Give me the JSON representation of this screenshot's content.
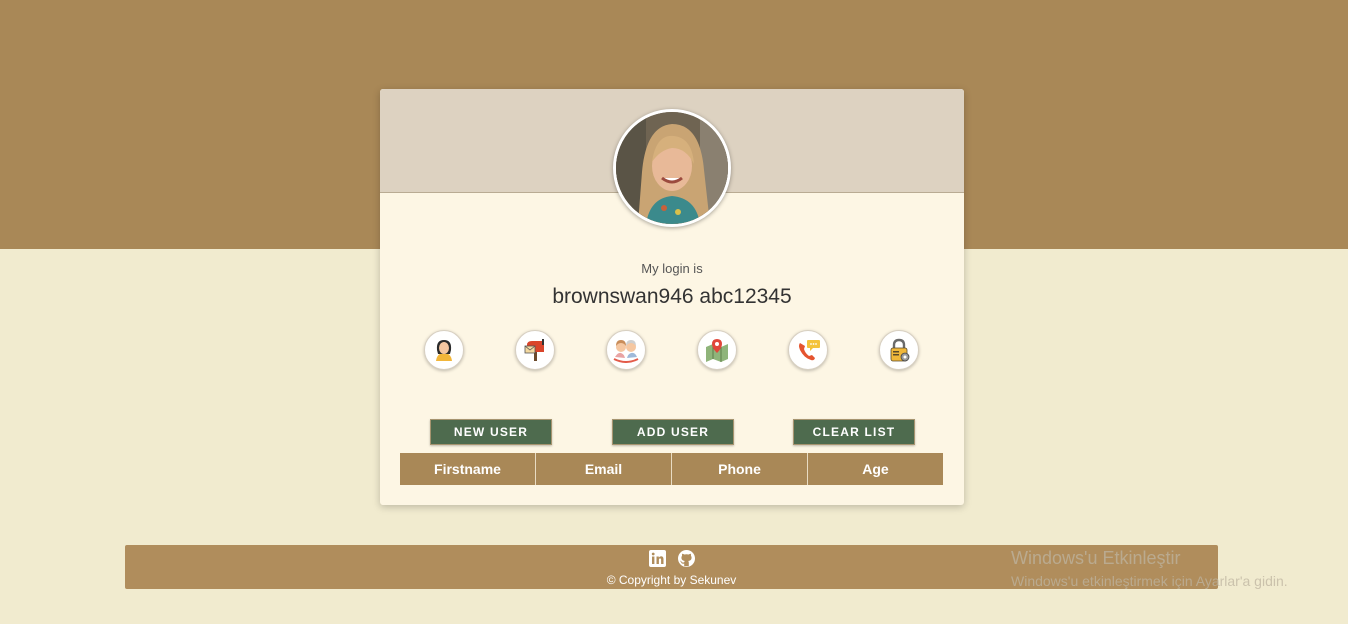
{
  "colors": {
    "top_band": "#a98857",
    "page_bg": "#f1ebcf",
    "card_bg": "#fdf6e4",
    "card_header": "#ddd2c1",
    "button": "#4e6b4e",
    "table_header": "#a98857",
    "footer": "#b08d5c"
  },
  "profile": {
    "login_label": "My login is",
    "login_value": "brownswan946 abc12345"
  },
  "icon_buttons": [
    "woman-avatar-icon",
    "mailbox-icon",
    "couple-age-icon",
    "map-location-icon",
    "phone-chat-icon",
    "padlock-icon"
  ],
  "buttons": {
    "new_user": "NEW USER",
    "add_user": "ADD USER",
    "clear_list": "CLEAR LIST"
  },
  "table": {
    "headers": [
      "Firstname",
      "Email",
      "Phone",
      "Age"
    ],
    "rows": []
  },
  "footer": {
    "icons": [
      "linkedin-icon",
      "github-icon"
    ],
    "copyright": "© Copyright by Sekunev"
  },
  "watermark": {
    "title": "Windows'u Etkinleştir",
    "subtitle": "Windows'u etkinleştirmek için Ayarlar'a gidin."
  }
}
